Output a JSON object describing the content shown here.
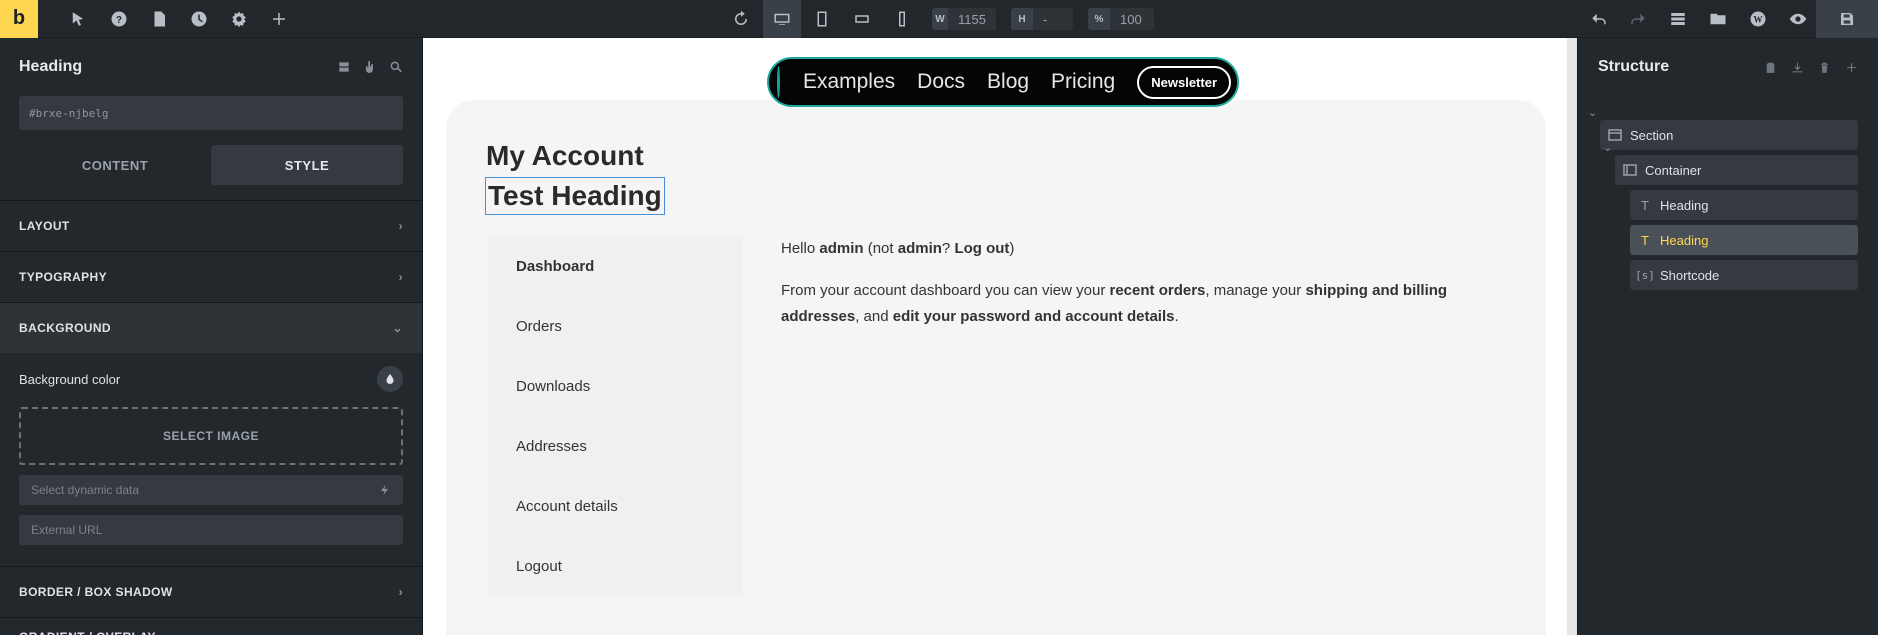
{
  "toolbar": {
    "logo": "b",
    "width_label": "W",
    "width_value": "1155",
    "height_label": "H",
    "height_value": "-",
    "zoom_label": "%",
    "zoom_value": "100"
  },
  "left_panel": {
    "title": "Heading",
    "element_id": "#brxe-njbelg",
    "tabs": [
      "CONTENT",
      "STYLE"
    ],
    "active_tab": "STYLE",
    "sections": {
      "layout": "LAYOUT",
      "typography": "TYPOGRAPHY",
      "background": "BACKGROUND",
      "border": "BORDER / BOX SHADOW",
      "gradient": "GRADIENT / OVERLAY"
    },
    "background": {
      "color_label": "Background color",
      "select_image": "SELECT IMAGE",
      "dynamic_placeholder": "Select dynamic data",
      "external_placeholder": "External URL"
    }
  },
  "canvas": {
    "nav": {
      "links": [
        "Examples",
        "Docs",
        "Blog",
        "Pricing"
      ],
      "button": "Newsletter"
    },
    "heading_account": "My Account",
    "heading_test": "Test Heading",
    "account_nav": [
      "Dashboard",
      "Orders",
      "Downloads",
      "Addresses",
      "Account details",
      "Logout"
    ],
    "content": {
      "hello_prefix": "Hello ",
      "hello_user": "admin",
      "hello_mid": " (not ",
      "hello_user2": "admin",
      "hello_q": "? ",
      "logout": "Log out",
      "hello_end": ")",
      "desc_1": "From your account dashboard you can view your ",
      "recent_orders": "recent orders",
      "desc_2": ", manage your ",
      "addresses": "shipping and billing addresses",
      "desc_3": ", and ",
      "edit": "edit your password and account details",
      "desc_4": "."
    }
  },
  "structure": {
    "title": "Structure",
    "items": [
      {
        "label": "Section",
        "icon": "section-icon"
      },
      {
        "label": "Container",
        "icon": "container-icon"
      },
      {
        "label": "Heading",
        "icon": "text-icon"
      },
      {
        "label": "Heading",
        "icon": "text-icon"
      },
      {
        "label": "Shortcode",
        "icon": "shortcode-icon"
      }
    ]
  },
  "colors": {
    "accent": "#ffd64f",
    "nav_teal": "#16a294",
    "panel_bg": "#23282d"
  }
}
